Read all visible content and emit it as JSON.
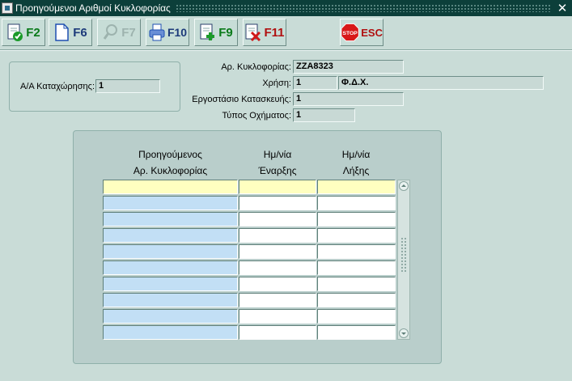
{
  "window": {
    "title": "Προηγούμενοι Αριθμοί Κυκλοφορίας",
    "close_glyph": "✕"
  },
  "toolbar": {
    "buttons": [
      {
        "label": "F2",
        "icon": "save-check-icon"
      },
      {
        "label": "F6",
        "icon": "new-document-icon"
      },
      {
        "label": "F7",
        "icon": "search-icon",
        "disabled": true
      },
      {
        "label": "F10",
        "icon": "printer-icon"
      },
      {
        "label": "F9",
        "icon": "add-record-icon"
      },
      {
        "label": "F11",
        "icon": "delete-record-icon"
      },
      {
        "label": "ESC",
        "icon": "stop-sign-icon",
        "stop_text": "STOP"
      }
    ]
  },
  "registration": {
    "label": "Α/Α Καταχώρησης:",
    "value": "1"
  },
  "vehicle": {
    "plate_label": "Αρ. Κυκλοφορίας:",
    "plate_value": "ZZA8323",
    "use_label": "Χρήση:",
    "use_code": "1",
    "use_desc": "Φ.Δ.Χ.",
    "factory_label": "Εργοστάσιο Κατασκευής:",
    "factory_value": "1",
    "type_label": "Τύπος Οχήματος:",
    "type_value": "1"
  },
  "table": {
    "columns": [
      {
        "line1": "Προηγούμενος",
        "line2": "Αρ. Κυκλοφορίας"
      },
      {
        "line1": "Ημ/νία",
        "line2": "Έναρξης"
      },
      {
        "line1": "Ημ/νία",
        "line2": "Λήξης"
      }
    ],
    "rows": [
      [
        "",
        "",
        ""
      ],
      [
        "",
        "",
        ""
      ],
      [
        "",
        "",
        ""
      ],
      [
        "",
        "",
        ""
      ],
      [
        "",
        "",
        ""
      ],
      [
        "",
        "",
        ""
      ],
      [
        "",
        "",
        ""
      ],
      [
        "",
        "",
        ""
      ],
      [
        "",
        "",
        ""
      ],
      [
        "",
        "",
        ""
      ]
    ]
  },
  "colors": {
    "title_bar": "#0c3f3a",
    "background": "#c9dcd7",
    "row_active": "#ffffc0",
    "plate_column": "#c2dff5",
    "date_column": "#ffffff"
  }
}
